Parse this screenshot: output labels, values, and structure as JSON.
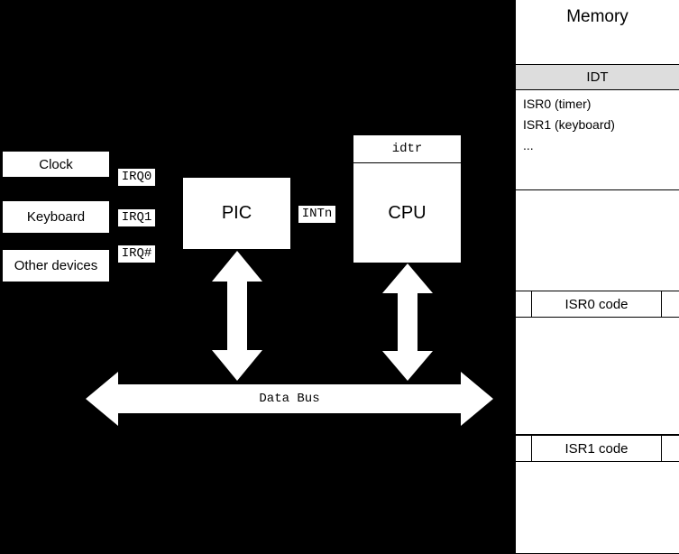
{
  "diagram": {
    "title_hidden": "PIC / CPU interrupt diagram",
    "devices": [
      {
        "label": "Clock",
        "irq": "IRQ0"
      },
      {
        "label": "Keyboard",
        "irq": "IRQ1"
      },
      {
        "label": "Other devices",
        "irq": "IRQ#"
      }
    ],
    "pic": {
      "label": "PIC"
    },
    "cpu": {
      "register_label": "idtr",
      "label": "CPU"
    },
    "signals": {
      "int_line": "INTn"
    },
    "bus": {
      "label": "Data Bus"
    },
    "arrows": {
      "pic_to_bus": "vertical-double-arrow",
      "cpu_to_bus": "vertical-double-arrow",
      "data_bus": "horizontal-double-arrow"
    },
    "memory": {
      "title": "Memory",
      "idt_header": "IDT",
      "idt_entries": [
        "ISR0 (timer)",
        "ISR1 (keyboard)",
        "..."
      ],
      "code_blocks": [
        "ISR0 code",
        "ISR1 code"
      ]
    },
    "colors": {
      "background": "#000000",
      "fill": "#ffffff",
      "stroke": "#000000",
      "header_fill": "#dddddd"
    }
  }
}
